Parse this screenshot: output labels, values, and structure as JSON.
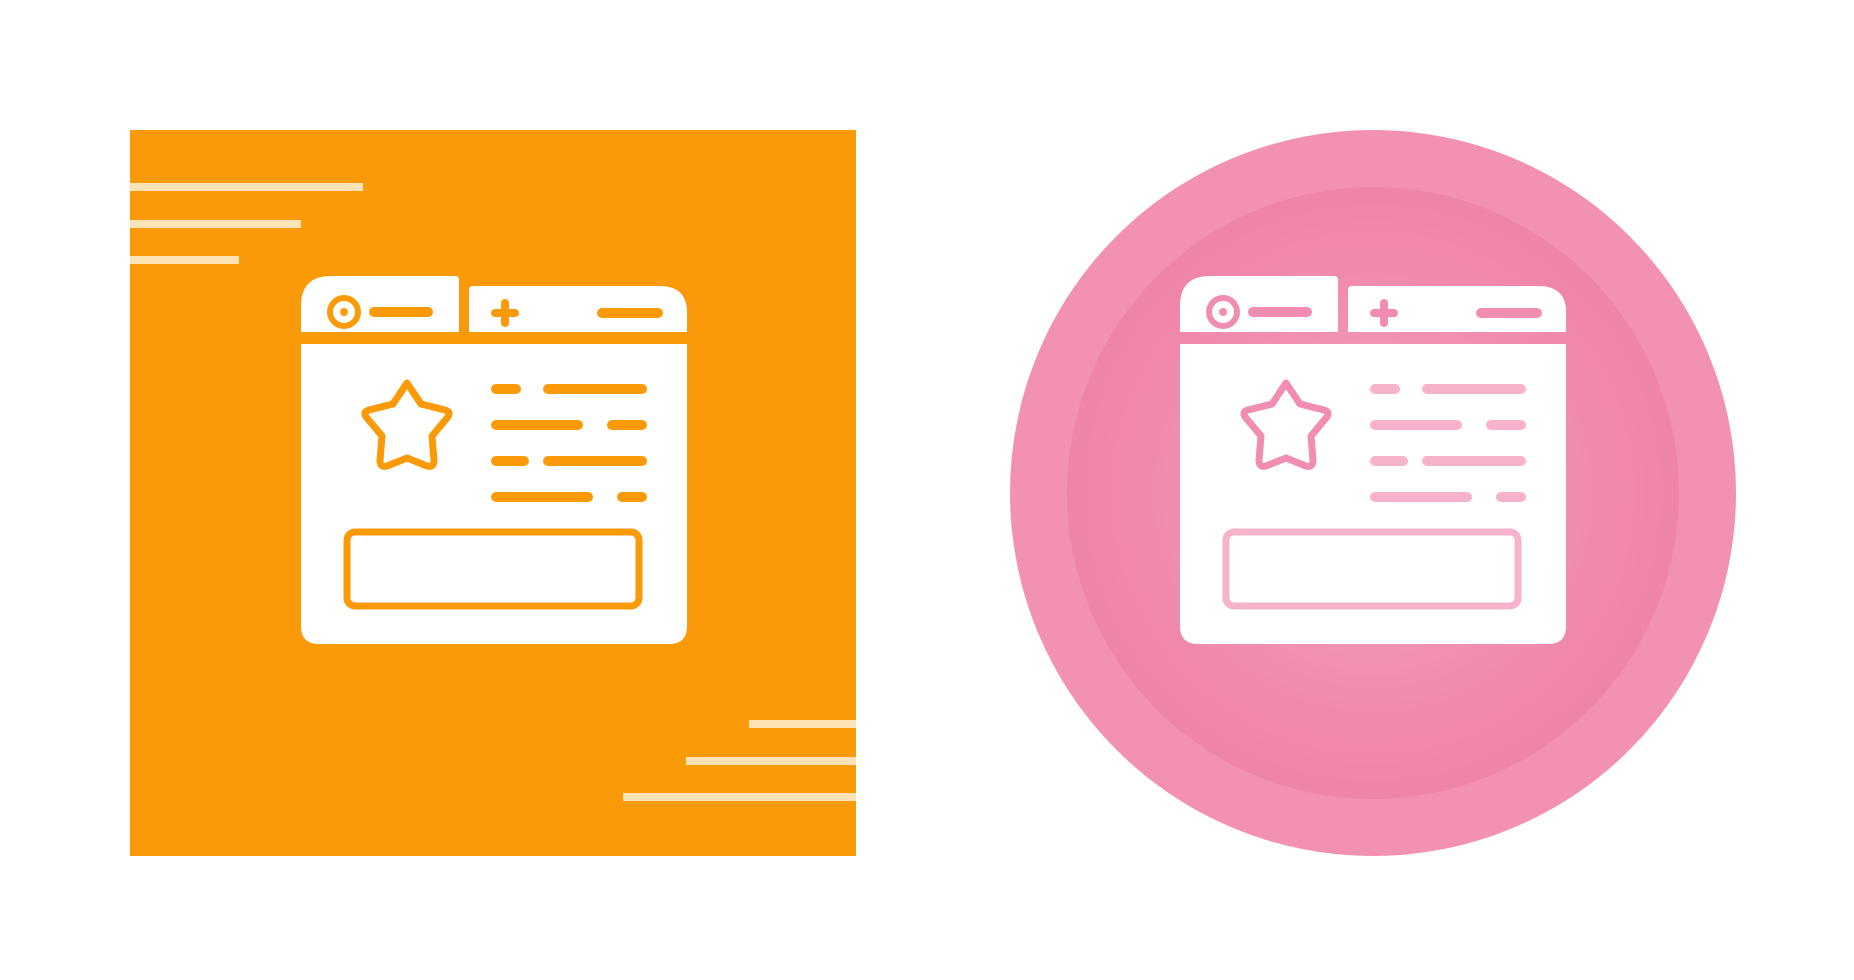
{
  "colors": {
    "background": "#ffffff",
    "orange_tile": "#fa9a08",
    "orange_accent": "#fa9a08",
    "tile_stripes": "#fbe3b6",
    "pink_outer": "#f291b1",
    "pink_inner": "#ef86a9",
    "pink_inner_glow": "#f5a3c0",
    "pink_accent": "#f08db0",
    "pink_light_accent": "#f6b3cb",
    "icon_white": "#ffffff"
  },
  "icons": {
    "left": {
      "name": "browser-window-star-icon",
      "variant": "square-orange"
    },
    "right": {
      "name": "browser-window-star-icon",
      "variant": "circle-pink"
    }
  }
}
